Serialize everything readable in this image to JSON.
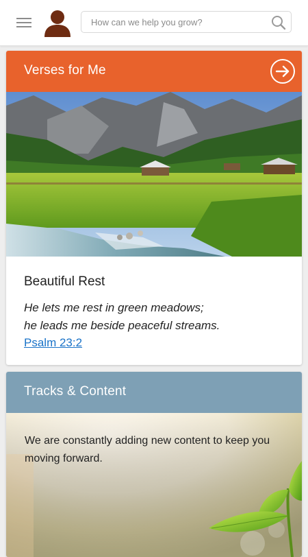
{
  "header": {
    "menu_icon": "hamburger-menu-icon",
    "avatar_icon": "user-avatar-icon",
    "search": {
      "placeholder": "How can we help you grow?",
      "value": "",
      "icon": "search-icon"
    }
  },
  "verses_card": {
    "title": "Verses for Me",
    "accent_color": "#e8622c",
    "arrow_icon": "arrow-right-circle-icon",
    "image": "mountain-meadow-stream-photo",
    "verse_title": "Beautiful Rest",
    "verse_lines": [
      "He lets me rest in green meadows;",
      "he leads me beside peaceful streams."
    ],
    "reference": "Psalm 23:2"
  },
  "tracks_card": {
    "title": "Tracks & Content",
    "accent_color": "#7ea0b5",
    "image": "sunlit-seedling-photo",
    "description": "We are constantly adding new content to keep you moving forward."
  }
}
